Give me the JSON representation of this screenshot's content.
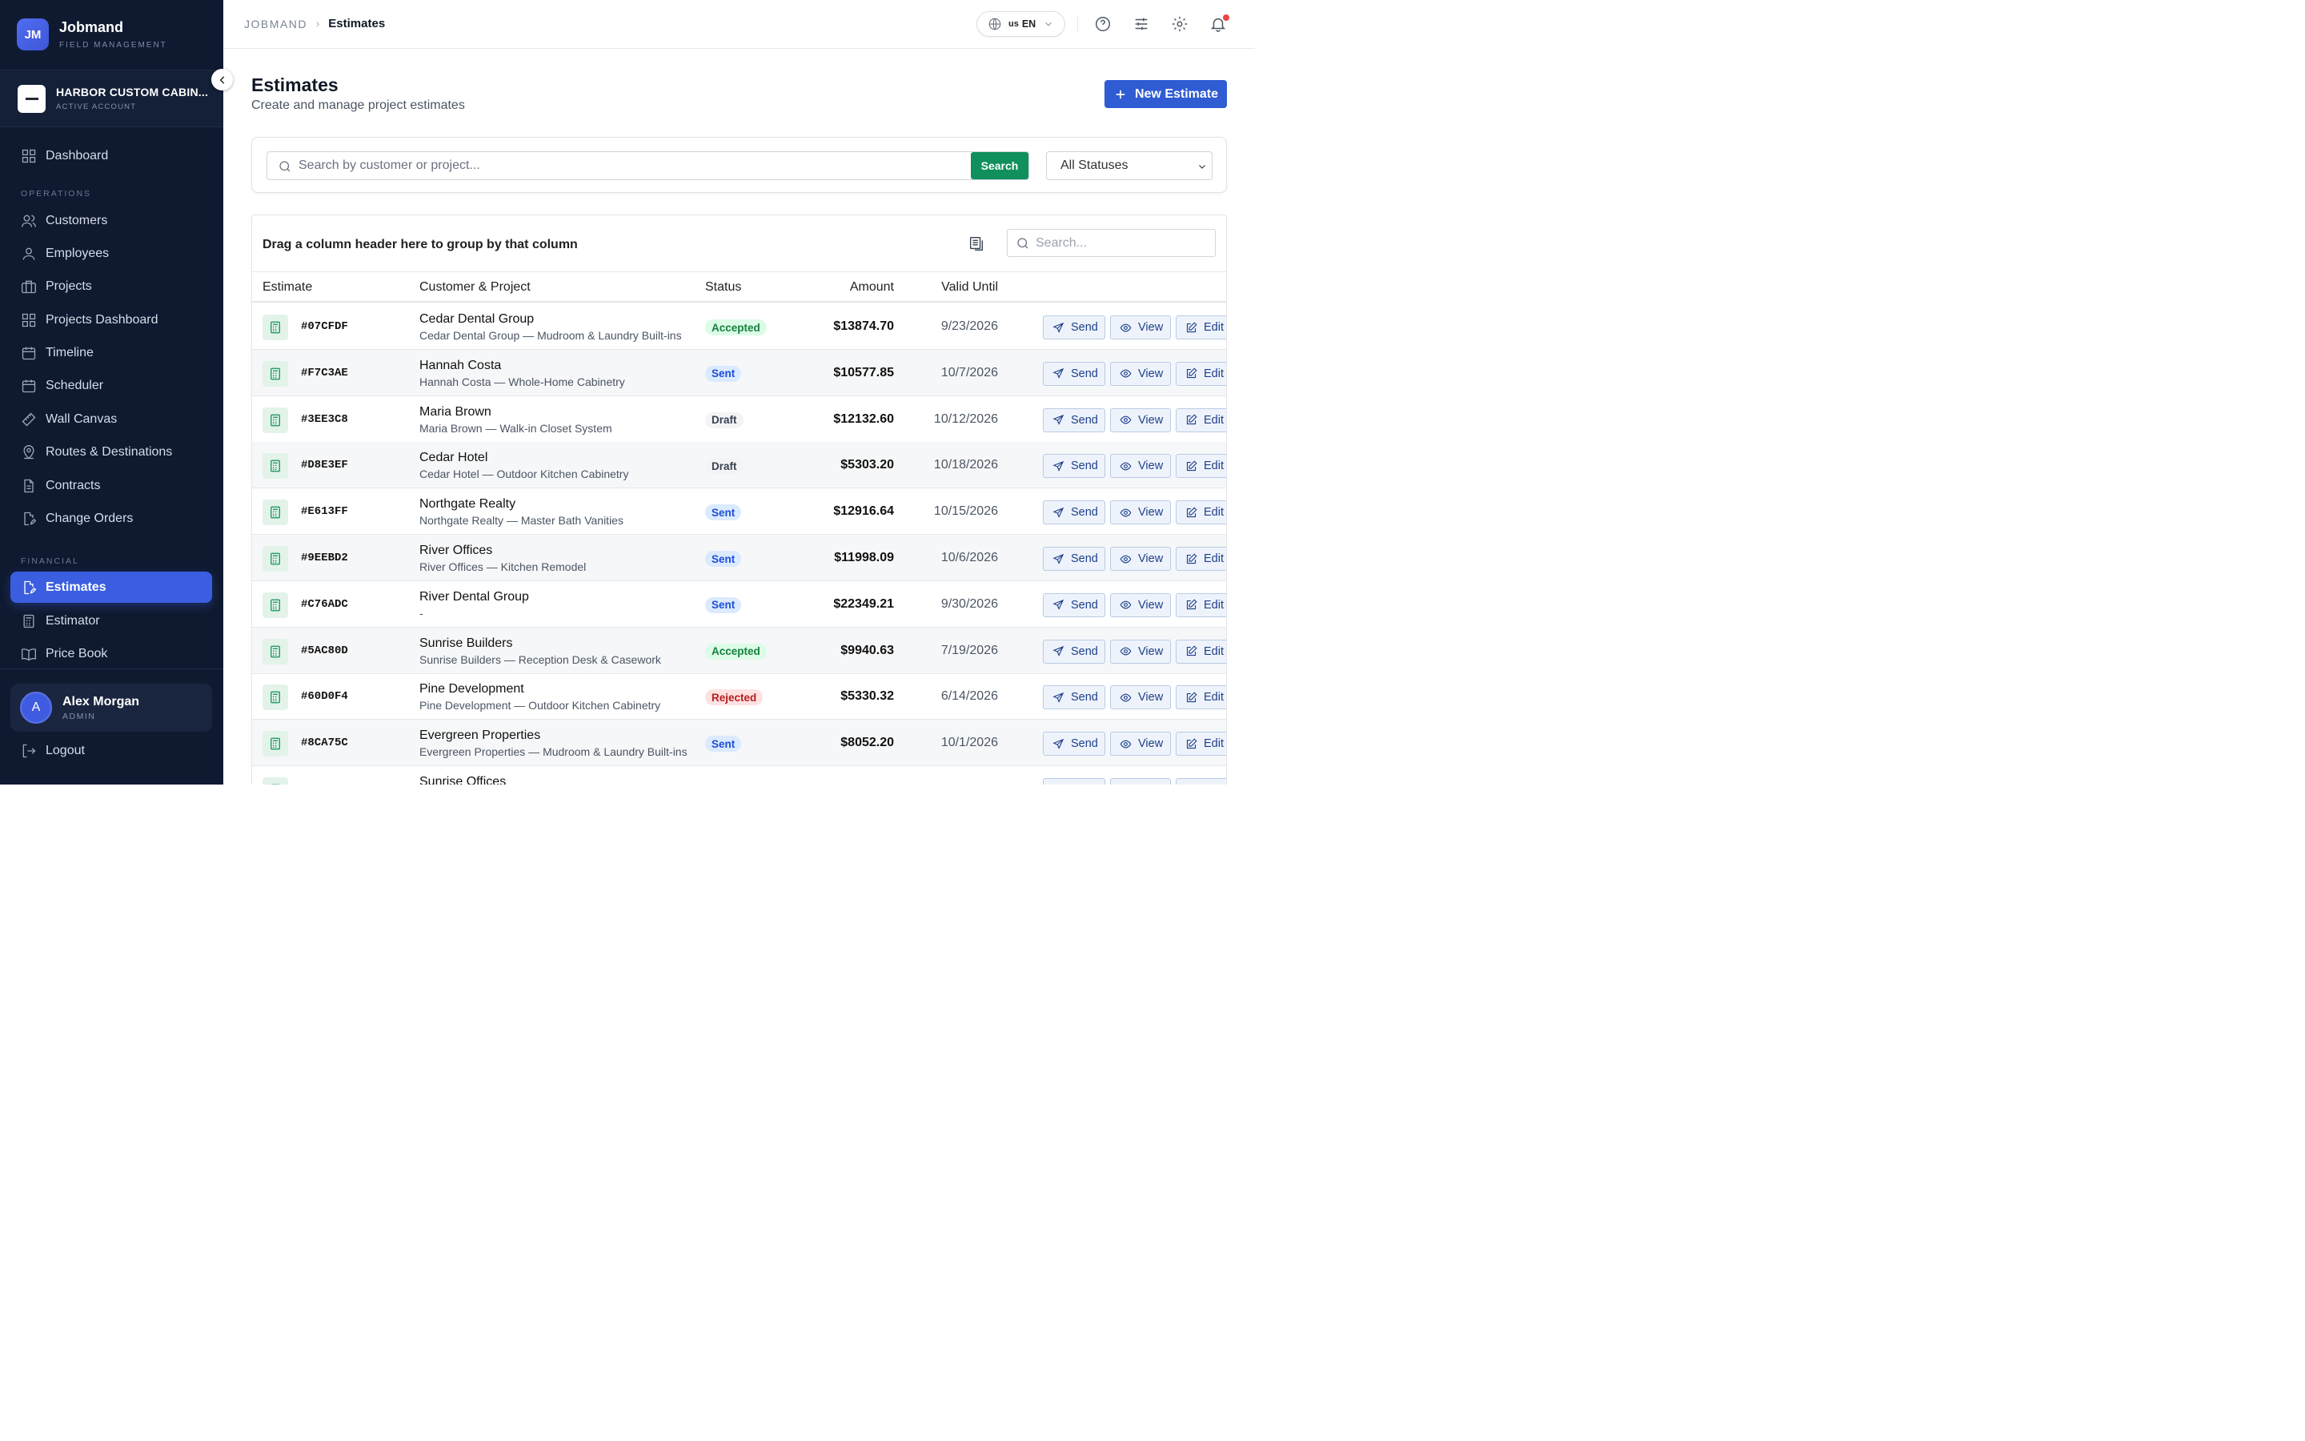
{
  "brand": {
    "logo_text": "JM",
    "name": "Jobmand",
    "subtitle": "FIELD MANAGEMENT"
  },
  "account": {
    "name": "HARBOR CUSTOM CABIN...",
    "status": "ACTIVE ACCOUNT"
  },
  "sidebar": {
    "dashboard": "Dashboard",
    "operations_label": "OPERATIONS",
    "operations": [
      {
        "label": "Customers",
        "icon": "users-icon"
      },
      {
        "label": "Employees",
        "icon": "user-icon"
      },
      {
        "label": "Projects",
        "icon": "briefcase-icon"
      },
      {
        "label": "Projects Dashboard",
        "icon": "grid-icon"
      },
      {
        "label": "Timeline",
        "icon": "calendar-icon"
      },
      {
        "label": "Scheduler",
        "icon": "calendar-icon"
      },
      {
        "label": "Wall Canvas",
        "icon": "ruler-icon"
      },
      {
        "label": "Routes & Destinations",
        "icon": "map-pin-icon"
      },
      {
        "label": "Contracts",
        "icon": "file-icon"
      },
      {
        "label": "Change Orders",
        "icon": "file-edit-icon"
      }
    ],
    "financial_label": "FINANCIAL",
    "financial": [
      {
        "label": "Estimates",
        "icon": "file-edit-icon",
        "active": true
      },
      {
        "label": "Estimator",
        "icon": "calculator-icon"
      },
      {
        "label": "Price Book",
        "icon": "book-icon"
      }
    ]
  },
  "user": {
    "initial": "A",
    "name": "Alex Morgan",
    "role": "ADMIN"
  },
  "logout": "Logout",
  "breadcrumb": {
    "root": "JOBMAND",
    "current": "Estimates"
  },
  "language": {
    "flag": "us",
    "code": "EN"
  },
  "page": {
    "title": "Estimates",
    "subtitle": "Create and manage project estimates",
    "new_button": "New Estimate"
  },
  "filters": {
    "search_placeholder": "Search by customer or project...",
    "search_button": "Search",
    "status_value": "All Statuses"
  },
  "grid": {
    "group_text": "Drag a column header here to group by that column",
    "search_placeholder": "Search...",
    "columns": {
      "estimate": "Estimate",
      "customer": "Customer & Project",
      "status": "Status",
      "amount": "Amount",
      "valid": "Valid Until"
    },
    "actions": {
      "send": "Send",
      "view": "View",
      "edit": "Edit"
    },
    "rows": [
      {
        "id": "#07CFDF",
        "customer": "Cedar Dental Group",
        "project": "Cedar Dental Group — Mudroom & Laundry Built-ins",
        "status": "Accepted",
        "amount": "$13874.70",
        "valid": "9/23/2026"
      },
      {
        "id": "#F7C3AE",
        "customer": "Hannah Costa",
        "project": "Hannah Costa — Whole-Home Cabinetry",
        "status": "Sent",
        "amount": "$10577.85",
        "valid": "10/7/2026"
      },
      {
        "id": "#3EE3C8",
        "customer": "Maria Brown",
        "project": "Maria Brown — Walk-in Closet System",
        "status": "Draft",
        "amount": "$12132.60",
        "valid": "10/12/2026"
      },
      {
        "id": "#D8E3EF",
        "customer": "Cedar Hotel",
        "project": "Cedar Hotel — Outdoor Kitchen Cabinetry",
        "status": "Draft",
        "amount": "$5303.20",
        "valid": "10/18/2026"
      },
      {
        "id": "#E613FF",
        "customer": "Northgate Realty",
        "project": "Northgate Realty — Master Bath Vanities",
        "status": "Sent",
        "amount": "$12916.64",
        "valid": "10/15/2026"
      },
      {
        "id": "#9EEBD2",
        "customer": "River Offices",
        "project": "River Offices — Kitchen Remodel",
        "status": "Sent",
        "amount": "$11998.09",
        "valid": "10/6/2026"
      },
      {
        "id": "#C76ADC",
        "customer": "River Dental Group",
        "project": "-",
        "status": "Sent",
        "amount": "$22349.21",
        "valid": "9/30/2026"
      },
      {
        "id": "#5AC80D",
        "customer": "Sunrise Builders",
        "project": "Sunrise Builders — Reception Desk & Casework",
        "status": "Accepted",
        "amount": "$9940.63",
        "valid": "7/19/2026"
      },
      {
        "id": "#60D0F4",
        "customer": "Pine Development",
        "project": "Pine Development — Outdoor Kitchen Cabinetry",
        "status": "Rejected",
        "amount": "$5330.32",
        "valid": "6/14/2026"
      },
      {
        "id": "#8CA75C",
        "customer": "Evergreen Properties",
        "project": "Evergreen Properties — Mudroom & Laundry Built-ins",
        "status": "Sent",
        "amount": "$8052.20",
        "valid": "10/1/2026"
      },
      {
        "id": "",
        "customer": "Sunrise Offices",
        "project": "",
        "status": "",
        "amount": "",
        "valid": ""
      }
    ]
  },
  "colors": {
    "sidebar_bg": "#0f1a30",
    "accent": "#3b5ee0",
    "primary_button": "#2f5bd3",
    "search_button": "#10905c",
    "accepted": "#15803d",
    "sent": "#1d4ed8",
    "draft": "#374151",
    "rejected": "#b91c1c"
  }
}
